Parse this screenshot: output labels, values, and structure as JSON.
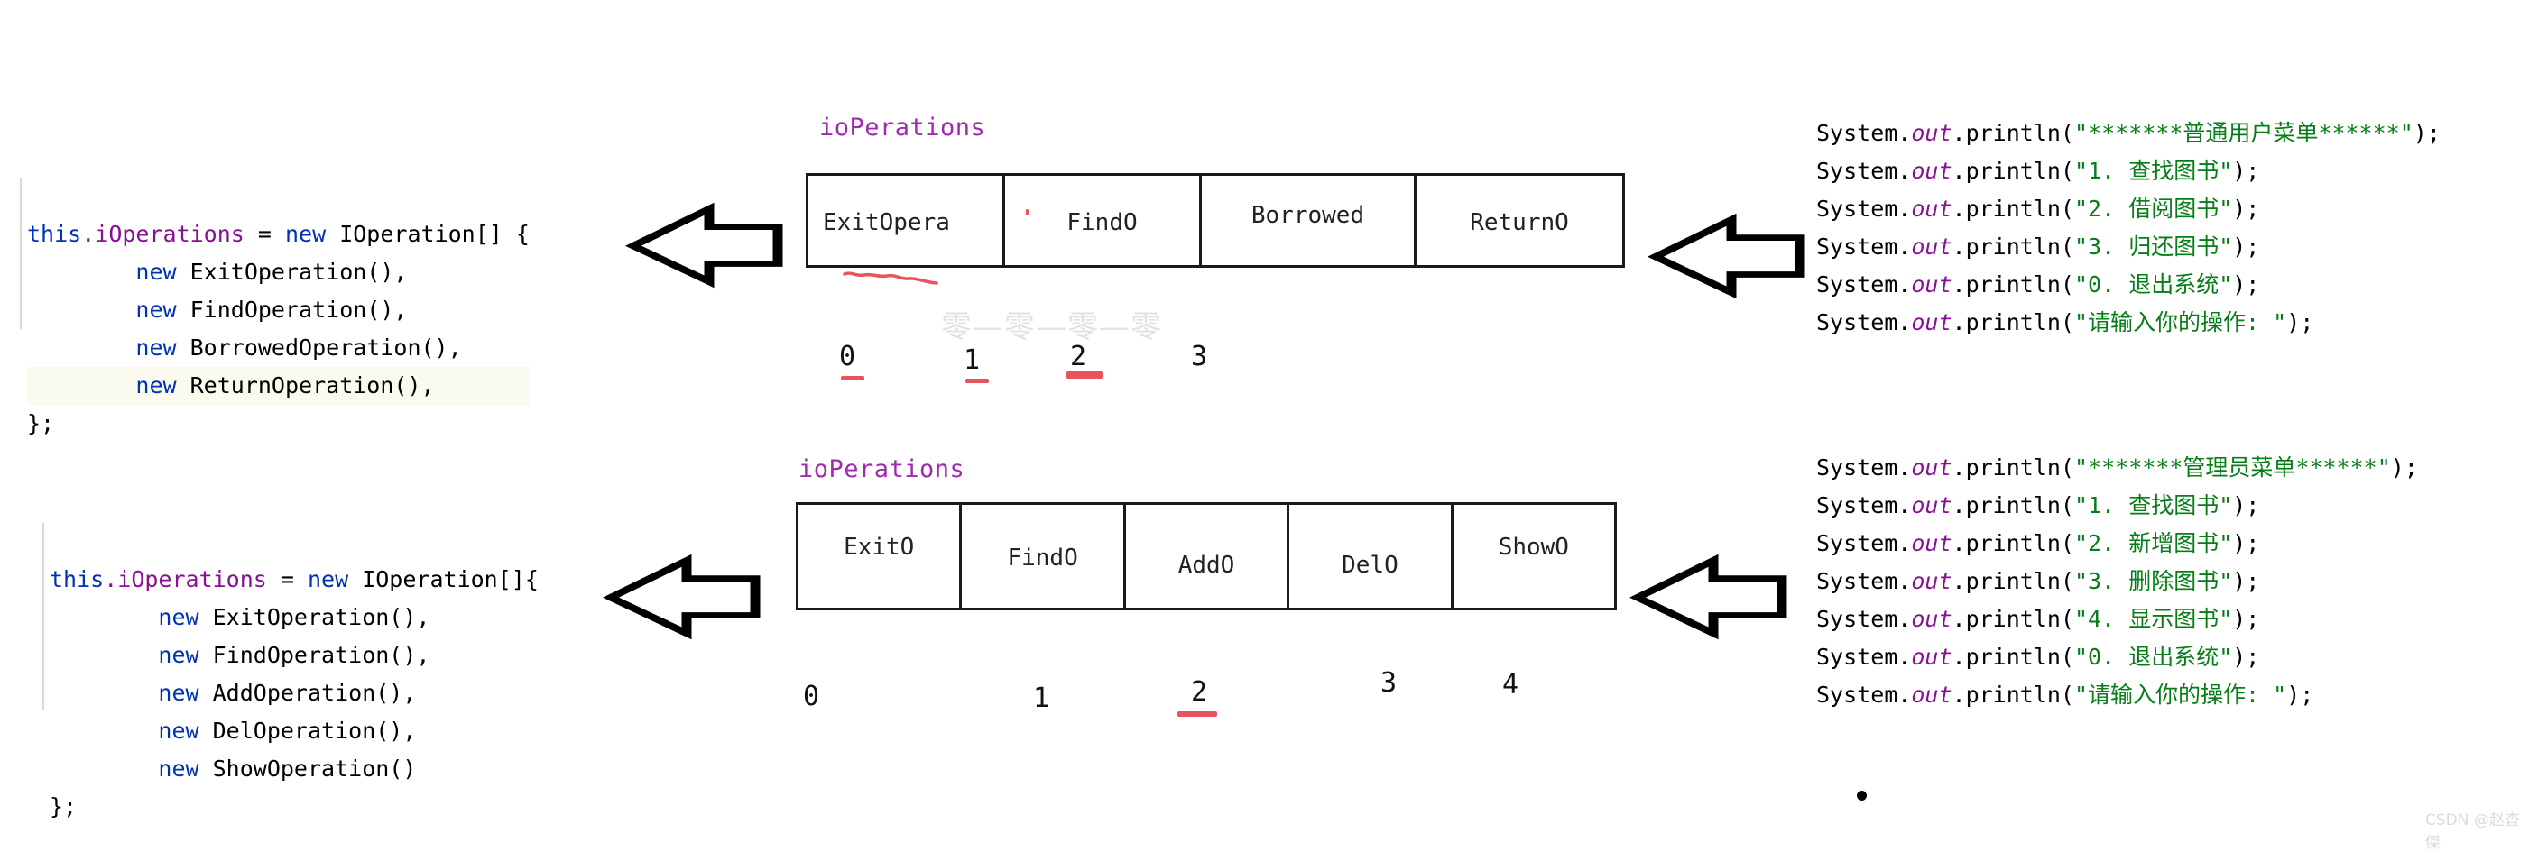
{
  "colors": {
    "keyword": "#0033b3",
    "field": "#871094",
    "string": "#067d17",
    "array_label": "#a02bb0",
    "annotation_red": "#e8545a",
    "box_border": "#1a1a1a",
    "highlight_line": "#fbfaee",
    "watermark": "#e2e2e2"
  },
  "left_code_top": {
    "lines": [
      {
        "tokens": [
          {
            "t": "this",
            "c": "kw"
          },
          {
            "t": ".iOperations",
            "c": "prop"
          },
          {
            "t": " = ",
            "c": "plain"
          },
          {
            "t": "new",
            "c": "kw"
          },
          {
            "t": " IOperation[] {",
            "c": "plain"
          }
        ],
        "highlight": false
      },
      {
        "tokens": [
          {
            "t": "        ",
            "c": "plain"
          },
          {
            "t": "new",
            "c": "kw"
          },
          {
            "t": " ExitOperation(),",
            "c": "plain"
          }
        ],
        "highlight": false
      },
      {
        "tokens": [
          {
            "t": "        ",
            "c": "plain"
          },
          {
            "t": "new",
            "c": "kw"
          },
          {
            "t": " FindOperation(),",
            "c": "plain"
          }
        ],
        "highlight": false
      },
      {
        "tokens": [
          {
            "t": "        ",
            "c": "plain"
          },
          {
            "t": "new",
            "c": "kw"
          },
          {
            "t": " BorrowedOperation(),",
            "c": "plain"
          }
        ],
        "highlight": false
      },
      {
        "tokens": [
          {
            "t": "        ",
            "c": "plain"
          },
          {
            "t": "new",
            "c": "kw"
          },
          {
            "t": " ReturnOperation(),",
            "c": "plain"
          }
        ],
        "highlight": true
      },
      {
        "tokens": [
          {
            "t": "};",
            "c": "plain"
          }
        ],
        "highlight": false
      }
    ]
  },
  "left_code_bottom": {
    "lines": [
      {
        "tokens": [
          {
            "t": "this",
            "c": "kw"
          },
          {
            "t": ".iOperations",
            "c": "prop"
          },
          {
            "t": " = ",
            "c": "plain"
          },
          {
            "t": "new",
            "c": "kw"
          },
          {
            "t": " IOperation[]{",
            "c": "plain"
          }
        ],
        "highlight": false
      },
      {
        "tokens": [
          {
            "t": "        ",
            "c": "plain"
          },
          {
            "t": "new",
            "c": "kw"
          },
          {
            "t": " ExitOperation(),",
            "c": "plain"
          }
        ],
        "highlight": false
      },
      {
        "tokens": [
          {
            "t": "        ",
            "c": "plain"
          },
          {
            "t": "new",
            "c": "kw"
          },
          {
            "t": " FindOperation(),",
            "c": "plain"
          }
        ],
        "highlight": false
      },
      {
        "tokens": [
          {
            "t": "        ",
            "c": "plain"
          },
          {
            "t": "new",
            "c": "kw"
          },
          {
            "t": " AddOperation(),",
            "c": "plain"
          }
        ],
        "highlight": false
      },
      {
        "tokens": [
          {
            "t": "        ",
            "c": "plain"
          },
          {
            "t": "new",
            "c": "kw"
          },
          {
            "t": " DelOperation(),",
            "c": "plain"
          }
        ],
        "highlight": false
      },
      {
        "tokens": [
          {
            "t": "        ",
            "c": "plain"
          },
          {
            "t": "new",
            "c": "kw"
          },
          {
            "t": " ShowOperation()",
            "c": "plain"
          }
        ],
        "highlight": false
      },
      {
        "tokens": [
          {
            "t": "};",
            "c": "plain"
          }
        ],
        "highlight": false
      }
    ]
  },
  "array_top": {
    "label": "ioPerations",
    "cells": [
      {
        "text": "ExitOpera",
        "clipped": true
      },
      {
        "text": "FindO",
        "clipped": false
      },
      {
        "text": "Borrowed",
        "clipped": false
      },
      {
        "text": "ReturnO",
        "clipped": false
      }
    ],
    "indices": [
      "0",
      "1",
      "2",
      "3"
    ],
    "watermark": "零—零—零—零"
  },
  "array_bottom": {
    "label": "ioPerations",
    "cells": [
      {
        "text": "ExitO",
        "clipped": false
      },
      {
        "text": "FindO",
        "clipped": false
      },
      {
        "text": "AddO",
        "clipped": false
      },
      {
        "text": "DelO",
        "clipped": false
      },
      {
        "text": "ShowO",
        "clipped": false
      }
    ],
    "indices": [
      "0",
      "1",
      "2",
      "3",
      "4"
    ]
  },
  "right_code_top": {
    "prefix": "System.",
    "field": "out",
    "method": ".println(",
    "suffix": ");",
    "lines": [
      "\"*******普通用户菜单******\"",
      "\"1. 查找图书\"",
      "\"2. 借阅图书\"",
      "\"3. 归还图书\"",
      "\"0. 退出系统\"",
      "\"请输入你的操作: \""
    ]
  },
  "right_code_bottom": {
    "prefix": "System.",
    "field": "out",
    "method": ".println(",
    "suffix": ");",
    "lines": [
      "\"*******管理员菜单******\"",
      "\"1. 查找图书\"",
      "\"2. 新增图书\"",
      "\"3. 删除图书\"",
      "\"4. 显示图书\"",
      "\"0. 退出系统\"",
      "\"请输入你的操作: \""
    ]
  },
  "watermarks": {
    "csdn": "CSDN @赵杳傑"
  }
}
